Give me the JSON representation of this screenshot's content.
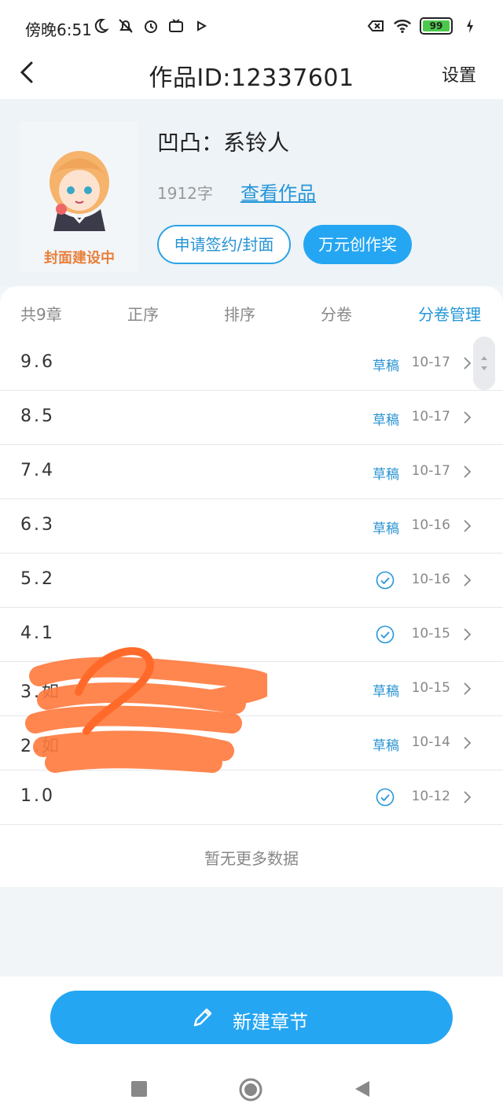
{
  "status_bar": {
    "time": "傍晚6:51",
    "left_icons": [
      "moon-icon",
      "bell-off-icon",
      "alarm-icon",
      "tv-icon",
      "play-icon"
    ],
    "right_icons": [
      "sim-off-icon",
      "wifi-icon"
    ],
    "battery_level": "99"
  },
  "navbar": {
    "back_icon": "chevron-left-icon",
    "title": "作品ID:12337601",
    "settings_label": "设置"
  },
  "work": {
    "cover_label": "封面建设中",
    "title": "凹凸：系铃人",
    "word_count": "1912字",
    "view_link": "查看作品",
    "apply_button": "申请签约/封面",
    "award_button": "万元创作奖"
  },
  "toolbar": {
    "chapter_count": "共9章",
    "order": "正序",
    "sort": "排序",
    "volume": "分卷",
    "volume_manage": "分卷管理"
  },
  "chapters": [
    {
      "title": "9.6",
      "status": "草稿",
      "date": "10-17"
    },
    {
      "title": "8.5",
      "status": "草稿",
      "date": "10-17"
    },
    {
      "title": "7.4",
      "status": "草稿",
      "date": "10-17"
    },
    {
      "title": "6.3",
      "status": "草稿",
      "date": "10-16"
    },
    {
      "title": "5.2",
      "status": "published",
      "date": "10-16"
    },
    {
      "title": "4.1",
      "status": "published",
      "date": "10-15"
    },
    {
      "title": "3.如",
      "status": "草稿",
      "date": "10-15"
    },
    {
      "title": "2.如",
      "status": "草稿",
      "date": "10-14"
    },
    {
      "title": "1.0",
      "status": "published",
      "date": "10-12"
    }
  ],
  "list_footer": "暂无更多数据",
  "bottom": {
    "new_chapter": "新建章节"
  },
  "colors": {
    "accent": "#25a6f2",
    "link": "#2596d8",
    "cover_text": "#e8803b",
    "scribble": "#ff7a3d"
  }
}
